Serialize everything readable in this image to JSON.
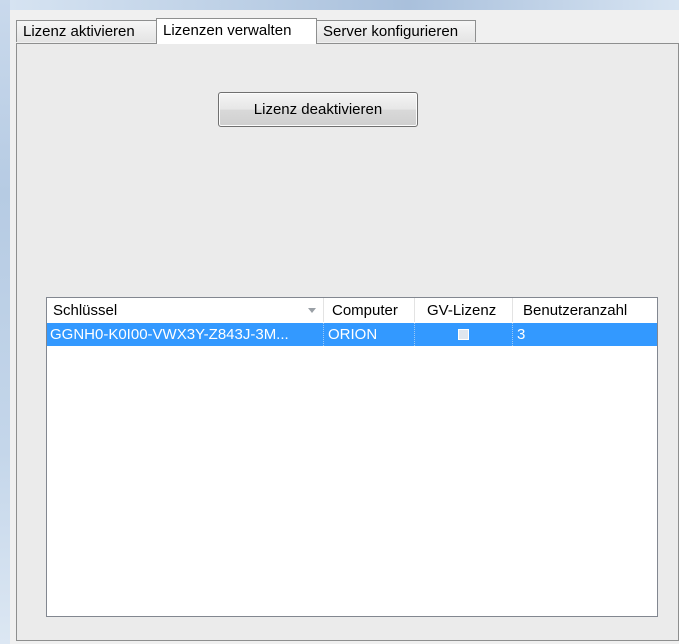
{
  "tabs": [
    {
      "label": "Lizenz aktivieren",
      "active": false
    },
    {
      "label": "Lizenzen verwalten",
      "active": true
    },
    {
      "label": "Server konfigurieren",
      "active": false
    }
  ],
  "panel": {
    "deactivate_button_label": "Lizenz deaktivieren"
  },
  "grid": {
    "columns": [
      "Schlüssel",
      "Computer",
      "GV-Lizenz",
      "Benutzeranzahl"
    ],
    "sorted_column": "Schlüssel",
    "rows": [
      {
        "key": "GGNH0-K0I00-VWX3Y-Z843J-3M...",
        "computer": "ORION",
        "gv_license_checked": false,
        "user_count": "3",
        "selected": true
      }
    ]
  },
  "colors": {
    "selection": "#3399ff",
    "panel_bg": "#ebebeb",
    "window_bg": "#f0f0f0"
  }
}
